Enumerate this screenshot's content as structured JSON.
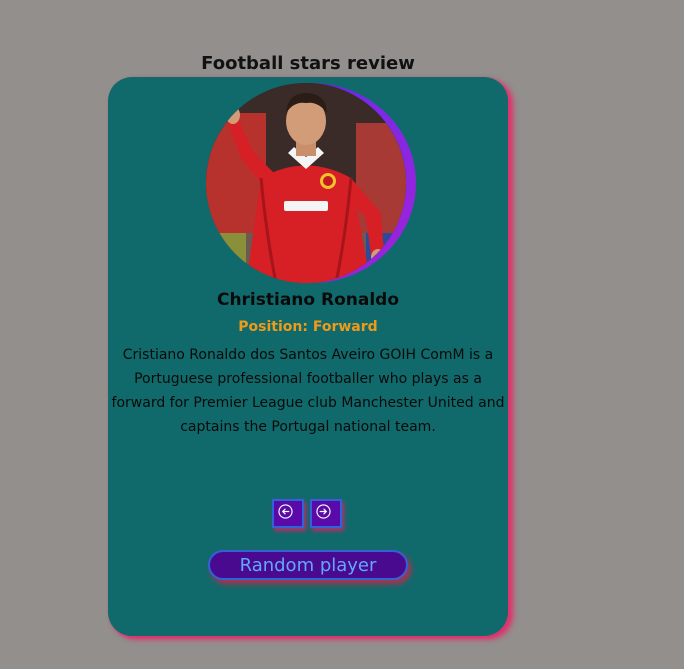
{
  "page": {
    "title": "Football stars review"
  },
  "card": {
    "player_name": "Christiano Ronaldo",
    "position_label": "Position: Forward",
    "bio": "Cristiano Ronaldo dos Santos Aveiro GOIH ComM is a Portuguese professional footballer who plays as a forward for Premier League club Manchester United and captains the Portugal national team.",
    "photo_alt": "Christiano Ronaldo",
    "prev_icon": "arrow-left-circle-icon",
    "next_icon": "arrow-right-circle-icon",
    "random_label": "Random player"
  },
  "colors": {
    "background": "#928f8d",
    "card": "#106a6c",
    "card_shadow": "#e0336b",
    "position_text": "#f09a1a",
    "button_fill": "#4a0a90",
    "button_border": "#2f63d8",
    "button_text": "#5fa8ff",
    "ring_gradient": [
      "#3a1bd2",
      "#a420d8"
    ]
  }
}
